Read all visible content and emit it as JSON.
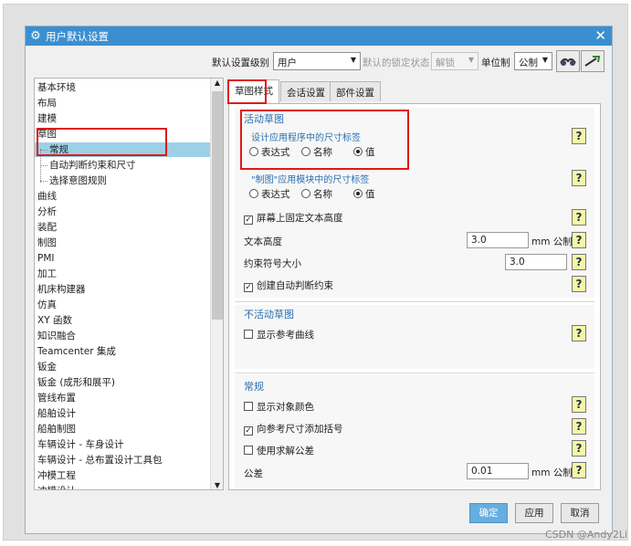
{
  "dialog": {
    "title": "用户默认设置",
    "close": "✕"
  },
  "toolbar": {
    "level_label": "默认设置级别",
    "level_value": "用户",
    "lock_label": "默认的锁定状态",
    "lock_value": "解锁",
    "unit_label": "单位制",
    "unit_value": "公制"
  },
  "tree": [
    {
      "label": "基本环境"
    },
    {
      "label": "布局"
    },
    {
      "label": "建模"
    },
    {
      "label": "草图"
    },
    {
      "label": "常规",
      "indent": true,
      "selected": true
    },
    {
      "label": "自动判断约束和尺寸",
      "indent": true
    },
    {
      "label": "选择意图规则",
      "indent": true
    },
    {
      "label": "曲线"
    },
    {
      "label": "分析"
    },
    {
      "label": "装配"
    },
    {
      "label": "制图"
    },
    {
      "label": "PMI"
    },
    {
      "label": "加工"
    },
    {
      "label": "机床构建器"
    },
    {
      "label": "仿真"
    },
    {
      "label": "XY 函数"
    },
    {
      "label": "知识融合"
    },
    {
      "label": "Teamcenter 集成"
    },
    {
      "label": "钣金"
    },
    {
      "label": "钣金 (成形和展平)"
    },
    {
      "label": "管线布置"
    },
    {
      "label": "船舶设计"
    },
    {
      "label": "船舶制图"
    },
    {
      "label": "车辆设计 - 车身设计"
    },
    {
      "label": "车辆设计 - 总布置设计工具包"
    },
    {
      "label": "冲模工程"
    },
    {
      "label": "冲模设计"
    }
  ],
  "tabs": [
    "草图样式",
    "会话设置",
    "部件设置"
  ],
  "active_section": {
    "title": "活动草图",
    "app_label": "设计应用程序中的尺寸标签",
    "draft_label": "\"制图\"应用模块中的尺寸标签",
    "radio_options": [
      "表达式",
      "名称",
      "值"
    ],
    "fix_text_label": "屏幕上固定文本高度",
    "text_height_label": "文本高度",
    "text_height_value": "3.0",
    "text_height_unit": "mm 公制",
    "constraint_size_label": "约束符号大小",
    "constraint_size_value": "3.0",
    "auto_constraint_label": "创建自动判断约束"
  },
  "inactive_section": {
    "title": "不活动草图",
    "show_ref_label": "显示参考曲线"
  },
  "general_section": {
    "title": "常规",
    "show_color_label": "显示对象颜色",
    "add_bracket_label": "向参考尺寸添加括号",
    "use_solver_label": "使用求解公差",
    "tolerance_label": "公差",
    "tolerance_value": "0.01",
    "tolerance_unit": "mm 公制"
  },
  "buttons": {
    "ok": "确定",
    "apply": "应用",
    "cancel": "取消"
  },
  "watermark": "CSDN @Andy2Li",
  "help_glyph": "?",
  "colors": {
    "title_bar": "#3b8fd0",
    "selection": "#9cd0e6",
    "section_title": "#2c6fb0",
    "highlight_box": "#e01818"
  }
}
